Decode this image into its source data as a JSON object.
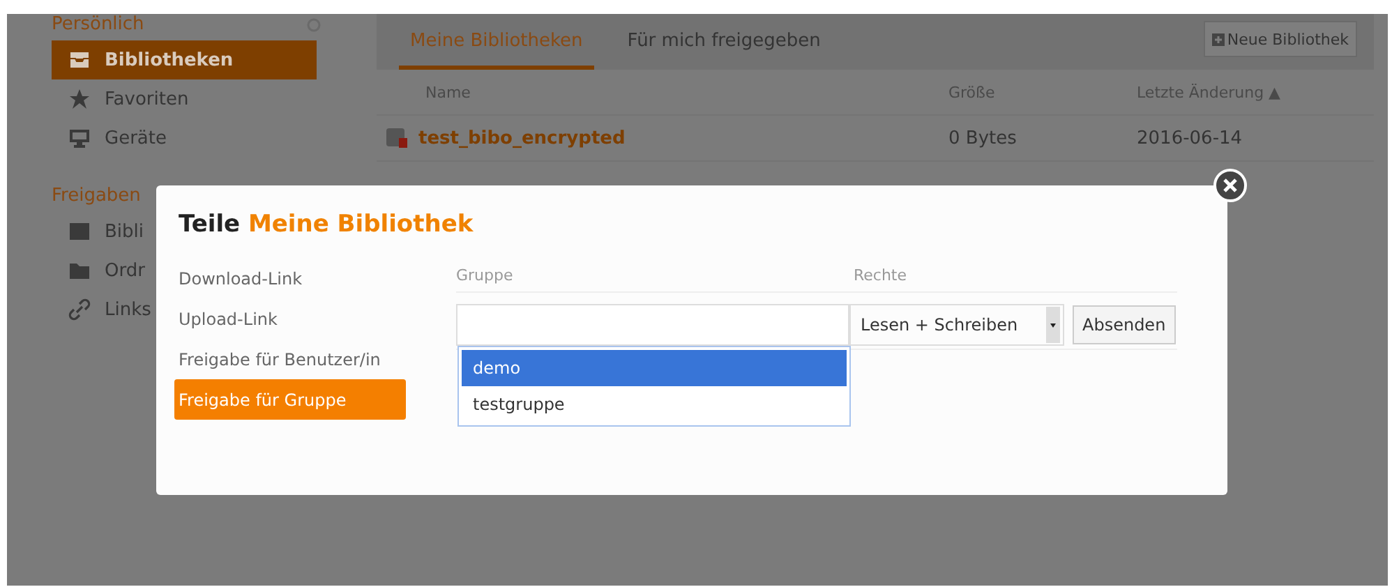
{
  "sidebar": {
    "sections": [
      {
        "title": "Persönlich",
        "items": [
          {
            "label": "Bibliotheken",
            "selected": true
          },
          {
            "label": "Favoriten",
            "selected": false
          },
          {
            "label": "Geräte",
            "selected": false
          }
        ]
      },
      {
        "title": "Freigaben",
        "items": [
          {
            "label": "Bibli",
            "selected": false
          },
          {
            "label": "Ordr",
            "selected": false
          },
          {
            "label": "Links",
            "selected": false
          }
        ]
      }
    ]
  },
  "main": {
    "tabs": [
      {
        "label": "Meine Bibliotheken",
        "selected": true
      },
      {
        "label": "Für mich freigegeben",
        "selected": false
      }
    ],
    "new_button": "Neue Bibliothek",
    "table": {
      "columns": [
        "Name",
        "Größe",
        "Letzte Änderung ▲"
      ],
      "rows": [
        {
          "name": "test_bibo_encrypted",
          "size": "0 Bytes",
          "modified": "2016-06-14",
          "encrypted": true
        }
      ]
    }
  },
  "dialog": {
    "title_prefix": "Teile",
    "title_name": "Meine Bibliothek",
    "nav": [
      {
        "label": "Download-Link",
        "selected": false
      },
      {
        "label": "Upload-Link",
        "selected": false
      },
      {
        "label": "Freigabe für Benutzer/in",
        "selected": false
      },
      {
        "label": "Freigabe für Gruppe",
        "selected": true
      }
    ],
    "columns": [
      "Gruppe",
      "Rechte"
    ],
    "group_options": [
      {
        "label": "demo",
        "selected": true
      },
      {
        "label": "testgruppe",
        "selected": false
      }
    ],
    "permission": "Lesen + Schreiben",
    "submit": "Absenden"
  }
}
